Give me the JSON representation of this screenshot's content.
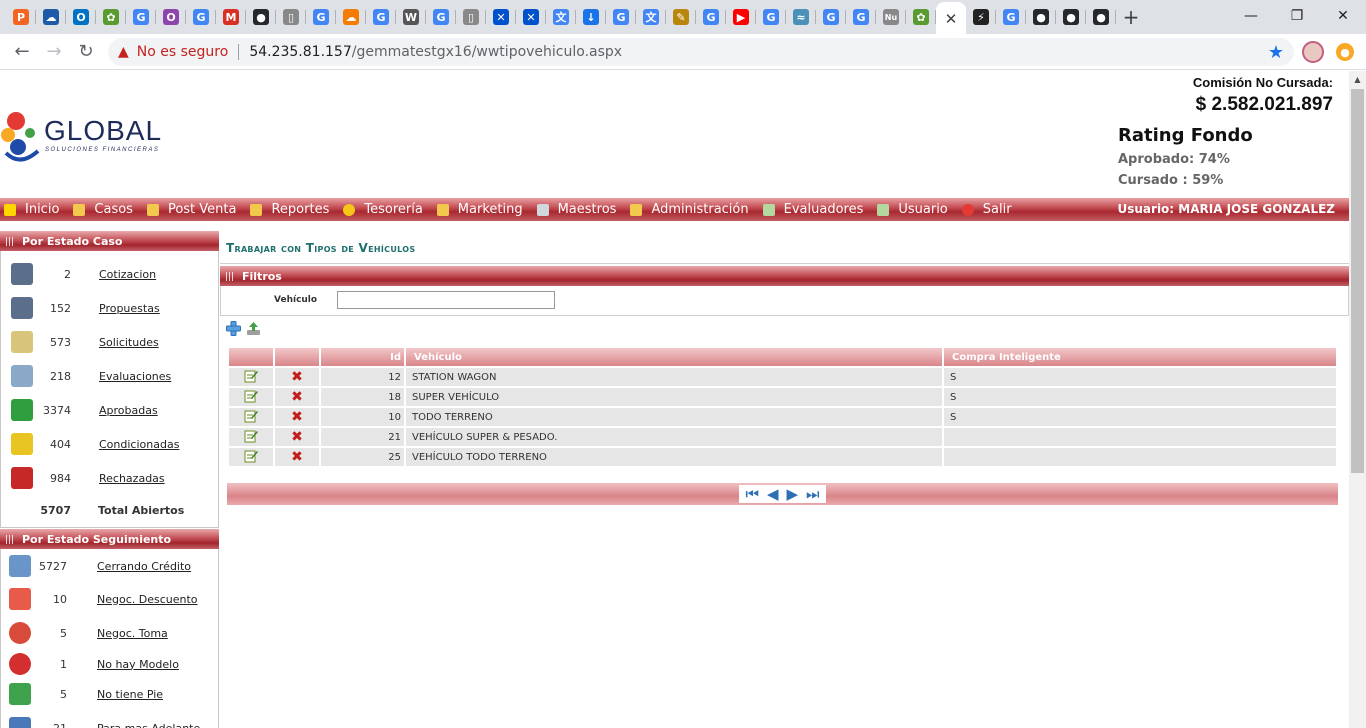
{
  "browser": {
    "tab_favicons": [
      {
        "name": "pipefy",
        "glyph": "P",
        "color": "#f26522"
      },
      {
        "name": "onedrive",
        "glyph": "☁",
        "color": "#1e5aa8"
      },
      {
        "name": "outlook",
        "glyph": "O",
        "color": "#0072c6"
      },
      {
        "name": "gemma",
        "glyph": "✿",
        "color": "#5a9b2f"
      },
      {
        "name": "google",
        "glyph": "G",
        "color": "#4285f4"
      },
      {
        "name": "opera",
        "glyph": "O",
        "color": "#8e44ad"
      },
      {
        "name": "google",
        "glyph": "G",
        "color": "#4285f4"
      },
      {
        "name": "gmail",
        "glyph": "M",
        "color": "#d93025"
      },
      {
        "name": "github",
        "glyph": "●",
        "color": "#24292e"
      },
      {
        "name": "document",
        "glyph": "▯",
        "color": "#888888"
      },
      {
        "name": "google",
        "glyph": "G",
        "color": "#4285f4"
      },
      {
        "name": "cloud",
        "glyph": "☁",
        "color": "#f57c00"
      },
      {
        "name": "google",
        "glyph": "G",
        "color": "#4285f4"
      },
      {
        "name": "wikipedia",
        "glyph": "W",
        "color": "#555555"
      },
      {
        "name": "google",
        "glyph": "G",
        "color": "#4285f4"
      },
      {
        "name": "document",
        "glyph": "▯",
        "color": "#888888"
      },
      {
        "name": "confluence",
        "glyph": "✕",
        "color": "#0052cc"
      },
      {
        "name": "confluence",
        "glyph": "✕",
        "color": "#0052cc"
      },
      {
        "name": "translate",
        "glyph": "文",
        "color": "#4285f4"
      },
      {
        "name": "download",
        "glyph": "↓",
        "color": "#1a73e8"
      },
      {
        "name": "google",
        "glyph": "G",
        "color": "#4285f4"
      },
      {
        "name": "translate",
        "glyph": "文",
        "color": "#4285f4"
      },
      {
        "name": "notepad",
        "glyph": "✎",
        "color": "#b8860b"
      },
      {
        "name": "google",
        "glyph": "G",
        "color": "#4285f4"
      },
      {
        "name": "youtube",
        "glyph": "▶",
        "color": "#ff0000"
      },
      {
        "name": "google",
        "glyph": "G",
        "color": "#4285f4"
      },
      {
        "name": "wave",
        "glyph": "≈",
        "color": "#4a90b8"
      },
      {
        "name": "google",
        "glyph": "G",
        "color": "#4285f4"
      },
      {
        "name": "google",
        "glyph": "G",
        "color": "#4285f4"
      },
      {
        "name": "nu",
        "glyph": "Nu",
        "color": "#888888"
      },
      {
        "name": "gemma",
        "glyph": "✿",
        "color": "#5a9b2f"
      }
    ],
    "active_tab_close": "✕",
    "tab_favicons_after": [
      {
        "name": "bolt",
        "glyph": "⚡",
        "color": "#222222"
      },
      {
        "name": "google",
        "glyph": "G",
        "color": "#4285f4"
      },
      {
        "name": "github",
        "glyph": "●",
        "color": "#24292e"
      },
      {
        "name": "github",
        "glyph": "●",
        "color": "#24292e"
      },
      {
        "name": "github",
        "glyph": "●",
        "color": "#24292e"
      }
    ],
    "new_tab": "+",
    "window": {
      "minimize": "—",
      "maximize": "❐",
      "close": "✕"
    },
    "nav": {
      "back": "←",
      "forward": "→",
      "reload": "↻"
    },
    "security_text": "No es seguro",
    "url_host": "54.235.81.157",
    "url_path": "/gemmatestgx16/wwtipovehiculo.aspx",
    "star": "★"
  },
  "header": {
    "logo_text": "GLOBAL",
    "logo_subtext": "SOLUCIONES FINANCIERAS",
    "commission_label": "Comisión No Cursada:",
    "commission_amount": "$ 2.582.021.897",
    "rating_title": "Rating Fondo",
    "approved": "Aprobado: 74%",
    "cursed": "Cursado : 59%"
  },
  "menu": {
    "items": [
      {
        "label": "Inicio",
        "icon": "home-icon",
        "color": "#ffd700"
      },
      {
        "label": "Casos",
        "icon": "folder-icon",
        "color": "#f2c94c"
      },
      {
        "label": "Post Venta",
        "icon": "folder-icon",
        "color": "#f2c94c"
      },
      {
        "label": "Reportes",
        "icon": "folder-icon",
        "color": "#f2c94c"
      },
      {
        "label": "Tesorería",
        "icon": "coin-icon",
        "color": "#f5c518"
      },
      {
        "label": "Marketing",
        "icon": "screen-icon",
        "color": "#f2c94c"
      },
      {
        "label": "Maestros",
        "icon": "database-icon",
        "color": "#cfd8dc"
      },
      {
        "label": "Administración",
        "icon": "key-icon",
        "color": "#f2c94c"
      },
      {
        "label": "Evaluadores",
        "icon": "users-icon",
        "color": "#b3d9a0"
      },
      {
        "label": "Usuario",
        "icon": "user-icon",
        "color": "#b3d9a0"
      },
      {
        "label": "Salir",
        "icon": "exit-icon",
        "color": "#e53935"
      }
    ],
    "user_label": "Usuario:  MARIA JOSE GONZALEZ"
  },
  "sidebar_case": {
    "title": "Por Estado Caso",
    "items": [
      {
        "count": "2",
        "label": "Cotizacion",
        "icon": "calculator-icon",
        "color": "#5b6f8a"
      },
      {
        "count": "152",
        "label": "Propuestas",
        "icon": "calculator-icon",
        "color": "#5b6f8a"
      },
      {
        "count": "573",
        "label": "Solicitudes",
        "icon": "notepad-icon",
        "color": "#d8c47a"
      },
      {
        "count": "218",
        "label": "Evaluaciones",
        "icon": "monitor-search-icon",
        "color": "#8aa8c8"
      },
      {
        "count": "3374",
        "label": "Aprobadas",
        "icon": "shield-check-icon",
        "color": "#2e9e3e"
      },
      {
        "count": "404",
        "label": "Condicionadas",
        "icon": "shield-warning-icon",
        "color": "#e8c520"
      },
      {
        "count": "984",
        "label": "Rechazadas",
        "icon": "shield-x-icon",
        "color": "#c62828"
      }
    ],
    "total_count": "5707",
    "total_label": "Total Abiertos"
  },
  "sidebar_follow": {
    "title": "Por Estado Seguimiento",
    "items": [
      {
        "count": "5727",
        "label": "Cerrando Crédito",
        "icon": "signing-icon",
        "color": "#6a95c9"
      },
      {
        "count": "10",
        "label": "Negoc. Descuento",
        "icon": "discount-tag-icon",
        "color": "#e85a4a"
      },
      {
        "count": "5",
        "label": "Negoc. Toma",
        "icon": "car-badge-icon",
        "color": "#d84a3a"
      },
      {
        "count": "1",
        "label": "No hay Modelo",
        "icon": "x-circle-icon",
        "color": "#d32f2f"
      },
      {
        "count": "5",
        "label": "No tiene Pie",
        "icon": "money-icon",
        "color": "#3fa34d"
      },
      {
        "count": "21",
        "label": "Para mas Adelante",
        "icon": "calendar-icon",
        "color": "#4a78b8"
      }
    ]
  },
  "main": {
    "title": "Trabajar con Tipos de Vehículos",
    "filters_title": "Filtros",
    "filter_label": "Vehículo",
    "filter_value": "",
    "grid": {
      "headers": [
        "",
        "",
        "Id",
        "Vehículo",
        "Compra Inteligente"
      ],
      "rows": [
        {
          "id": "12",
          "vehicle": "STATION WAGON",
          "smart": "S"
        },
        {
          "id": "18",
          "vehicle": "SUPER VEHÍCULO",
          "smart": "S"
        },
        {
          "id": "10",
          "vehicle": "TODO TERRENO",
          "smart": "S"
        },
        {
          "id": "21",
          "vehicle": "VEHÍCULO SUPER & PESADO.",
          "smart": ""
        },
        {
          "id": "25",
          "vehicle": "VEHÍCULO TODO TERRENO",
          "smart": ""
        }
      ]
    },
    "pager": {
      "first": "⏮",
      "prev": "◀",
      "next": "▶",
      "last": "⏭"
    }
  }
}
